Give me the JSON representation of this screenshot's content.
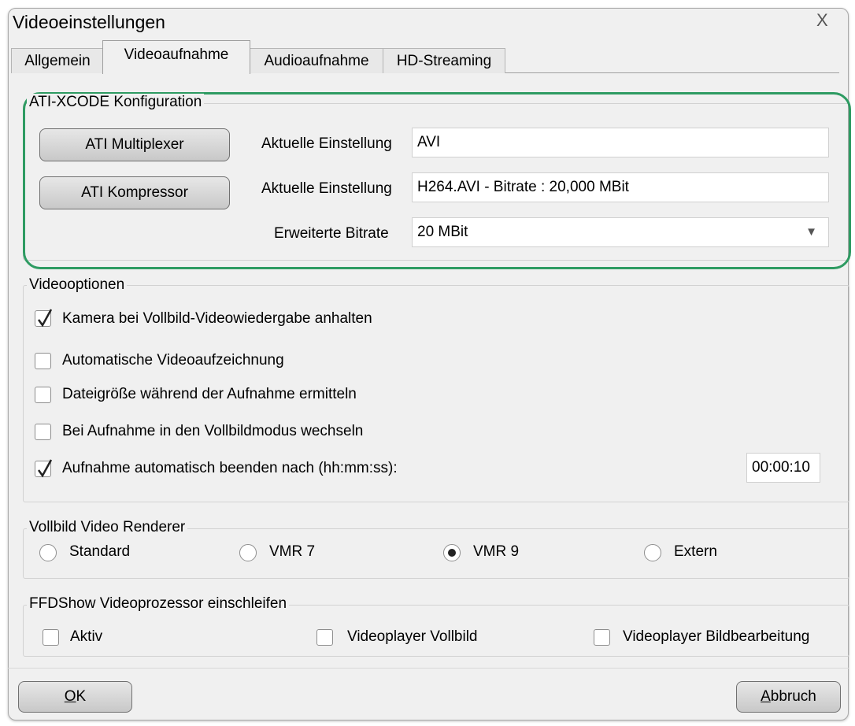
{
  "window": {
    "title": "Videoeinstellungen",
    "close_glyph": "X"
  },
  "tabs": [
    {
      "label": "Allgemein",
      "active": false
    },
    {
      "label": "Videoaufnahme",
      "active": true
    },
    {
      "label": "Audioaufnahme",
      "active": false
    },
    {
      "label": "HD-Streaming",
      "active": false
    }
  ],
  "ati": {
    "legend": "ATI-XCODE Konfiguration",
    "multiplexer_button": "ATI Multiplexer",
    "kompressor_button": "ATI Kompressor",
    "row1_label": "Aktuelle Einstellung",
    "row1_value": "AVI",
    "row2_label": "Aktuelle Einstellung",
    "row2_value": "H264.AVI - Bitrate : 20,000 MBit",
    "bitrate_label": "Erweiterte Bitrate",
    "bitrate_value": "20 MBit",
    "highlight_color": "#2e9b62"
  },
  "videooptionen": {
    "legend": "Videooptionen",
    "items": [
      {
        "label": "Kamera bei Vollbild-Videowiedergabe anhalten",
        "checked": true
      },
      {
        "label": "Automatische Videoaufzeichnung",
        "checked": false
      },
      {
        "label": "Dateigröße während der Aufnahme ermitteln",
        "checked": false
      },
      {
        "label": "Bei Aufnahme in den Vollbildmodus wechseln",
        "checked": false
      },
      {
        "label": "Aufnahme automatisch beenden nach (hh:mm:ss):",
        "checked": true
      }
    ],
    "stop_after_value": "00:00:10"
  },
  "renderer": {
    "legend": "Vollbild Video Renderer",
    "options": [
      {
        "label": "Standard",
        "selected": false
      },
      {
        "label": "VMR 7",
        "selected": false
      },
      {
        "label": "VMR 9",
        "selected": true
      },
      {
        "label": "Extern",
        "selected": false
      }
    ]
  },
  "ffdshow": {
    "legend": "FFDShow Videoprozessor einschleifen",
    "items": [
      {
        "label": "Aktiv",
        "checked": false
      },
      {
        "label": "Videoplayer Vollbild",
        "checked": false
      },
      {
        "label": "Videoplayer Bildbearbeitung",
        "checked": false
      }
    ]
  },
  "footer": {
    "ok_mnemonic": "O",
    "ok_rest": "K",
    "cancel_mnemonic": "A",
    "cancel_rest": "bbruch"
  }
}
